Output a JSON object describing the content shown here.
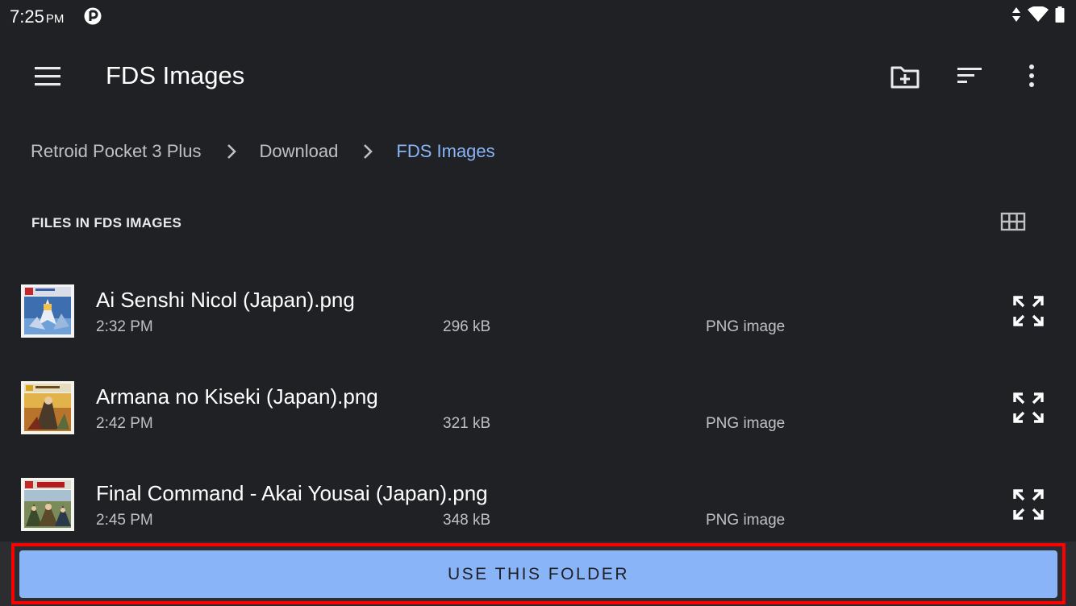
{
  "status_bar": {
    "time": "7:25",
    "ampm": "PM",
    "app_icon": "retroid-launcher-icon",
    "icons": [
      "data-transfer-icon",
      "wifi-icon",
      "battery-icon"
    ]
  },
  "app_bar": {
    "menu_icon": "menu-icon",
    "title": "FDS Images",
    "actions": [
      "new-folder-icon",
      "sort-icon",
      "more-vert-icon"
    ]
  },
  "breadcrumb": {
    "items": [
      "Retroid Pocket 3 Plus",
      "Download",
      "FDS Images"
    ]
  },
  "section": {
    "title": "FILES IN FDS IMAGES",
    "view_toggle_icon": "grid-view-icon"
  },
  "files": [
    {
      "name": "Ai Senshi Nicol (Japan).png",
      "time": "2:32 PM",
      "size": "296 kB",
      "type": "PNG image"
    },
    {
      "name": "Armana no Kiseki (Japan).png",
      "time": "2:42 PM",
      "size": "321 kB",
      "type": "PNG image"
    },
    {
      "name": "Final Command - Akai Yousai (Japan).png",
      "time": "2:45 PM",
      "size": "348 kB",
      "type": "PNG image"
    }
  ],
  "bottom": {
    "button_label": "USE THIS FOLDER"
  },
  "colors": {
    "background": "#202124",
    "accent": "#8ab4f8",
    "highlight": "#ff0000"
  }
}
